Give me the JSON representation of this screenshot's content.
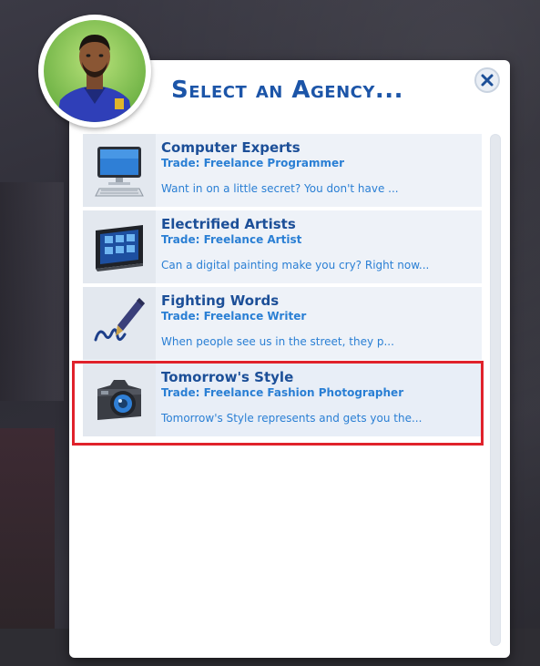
{
  "dialog": {
    "title": "Select an Agency...",
    "close_label": "close",
    "accent_color": "#1c55a8",
    "highlight_color": "#e0222b"
  },
  "agencies": [
    {
      "name": "Computer Experts",
      "trade": "Trade: Freelance Programmer",
      "description": "Want in on a little secret? You don't have ...",
      "icon": "computer-monitor-icon"
    },
    {
      "name": "Electrified Artists",
      "trade": "Trade: Freelance Artist",
      "description": "Can a digital painting make you cry? Right now...",
      "icon": "drawing-tablet-icon"
    },
    {
      "name": "Fighting Words",
      "trade": "Trade: Freelance Writer",
      "description": "When people see us in the street, they p...",
      "icon": "fountain-pen-icon"
    },
    {
      "name": "Tomorrow's Style",
      "trade": "Trade: Freelance Fashion Photographer",
      "description": "Tomorrow's Style represents and gets you the...",
      "icon": "camera-icon"
    }
  ]
}
